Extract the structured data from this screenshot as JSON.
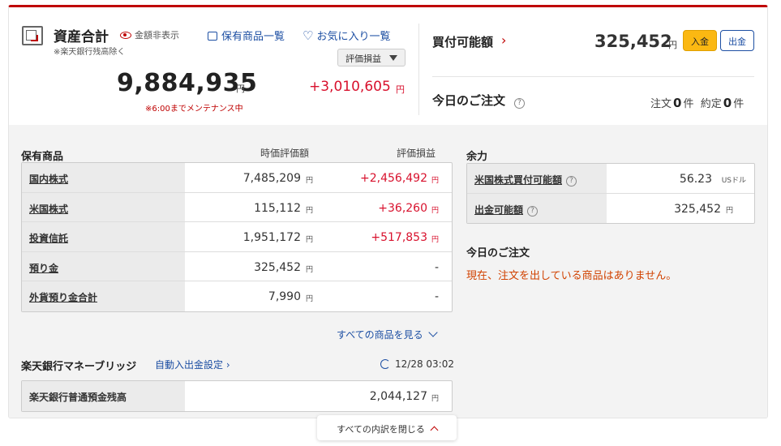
{
  "summary": {
    "title": "資産合計",
    "hide_amount_label": "金額非表示",
    "bank_note": "※楽天銀行残高除く",
    "link_holdings": "保有商品一覧",
    "link_favorites": "お気に入り一覧",
    "pl_select": "評価損益",
    "total_value": "9,884,935",
    "total_yen": "円",
    "total_pl": "+3,010,605",
    "total_pl_yen": "円",
    "maintenance": "※6:00までメンテナンス中"
  },
  "buying_power": {
    "title": "買付可能額",
    "chevron": "›",
    "value": "325,452",
    "yen": "円",
    "deposit_label": "入金",
    "withdraw_label": "出金"
  },
  "today_order": {
    "title": "今日のご注文",
    "help": "?",
    "order_label": "注文",
    "order_count": "0",
    "order_unit": "件",
    "filled_label": "約定",
    "filled_count": "0",
    "filled_unit": "件"
  },
  "holdings": {
    "title": "保有商品",
    "col_value": "時価評価額",
    "col_pl": "評価損益",
    "rows": [
      {
        "label": "国内株式",
        "value": "7,485,209",
        "yen": "円",
        "pl": "+2,456,492",
        "pl_yen": "円"
      },
      {
        "label": "米国株式",
        "value": "115,112",
        "yen": "円",
        "pl": "+36,260",
        "pl_yen": "円"
      },
      {
        "label": "投資信託",
        "value": "1,951,172",
        "yen": "円",
        "pl": "+517,853",
        "pl_yen": "円"
      },
      {
        "label": "預り金",
        "value": "325,452",
        "yen": "円",
        "pl": "-",
        "pl_yen": ""
      },
      {
        "label": "外貨預り金合計",
        "value": "7,990",
        "yen": "円",
        "pl": "-",
        "pl_yen": ""
      }
    ],
    "see_all": "すべての商品を見る"
  },
  "bridge": {
    "title": "楽天銀行マネーブリッジ",
    "auto_link": "自動入出金設定 ›",
    "updated": "12/28 03:02",
    "row_label": "楽天銀行普通預金残高",
    "row_value": "2,044,127",
    "row_yen": "円"
  },
  "margin": {
    "title": "余力",
    "rows": [
      {
        "label": "米国株式買付可能額",
        "value": "56.23",
        "unit": "USドル"
      },
      {
        "label": "出金可能額",
        "value": "325,452",
        "unit": "円"
      }
    ]
  },
  "today_detail": {
    "title": "今日のご注文",
    "message": "現在、注文を出している商品はありません。"
  },
  "footer": {
    "close_label": "すべての内訳を閉じる"
  },
  "colors": {
    "brand_red": "#bf0000",
    "plus_red": "#d8112d",
    "link_blue": "#1d4fa3",
    "deposit_yellow": "#fbb812",
    "notice_orange": "#d14200"
  }
}
